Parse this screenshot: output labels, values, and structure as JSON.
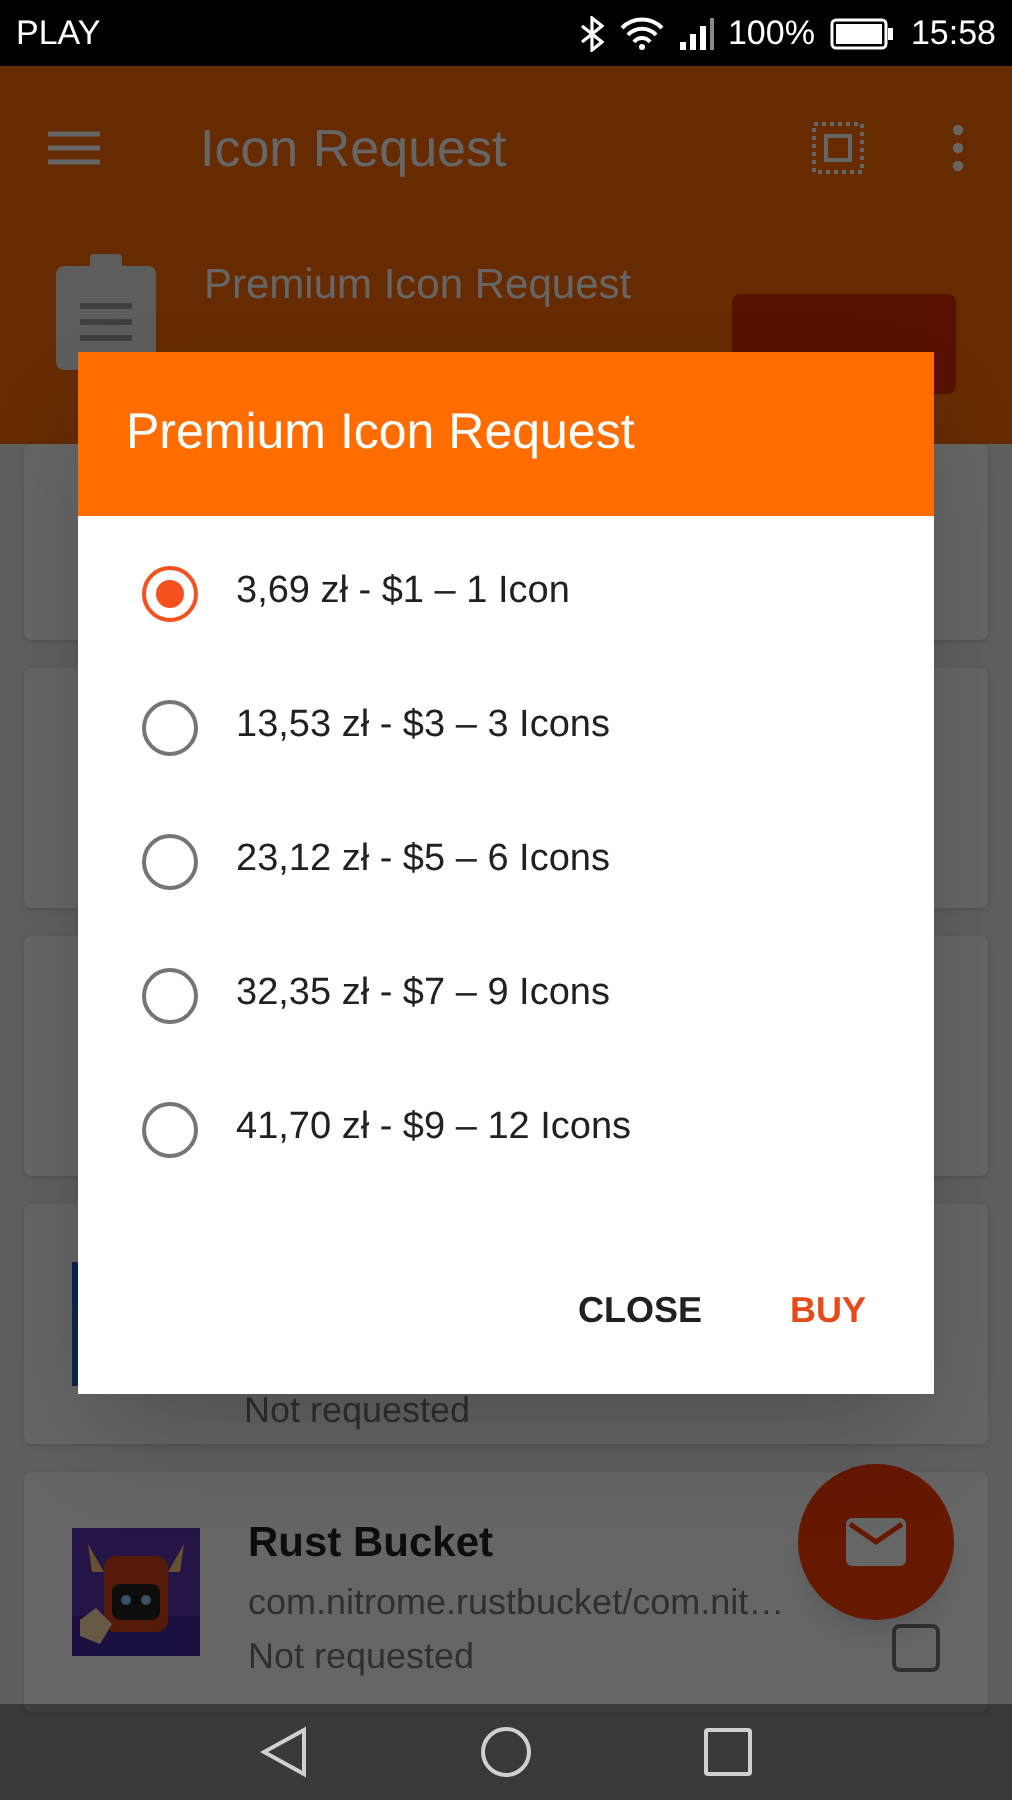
{
  "status_bar": {
    "carrier": "PLAY",
    "battery": "100%",
    "time": "15:58"
  },
  "toolbar": {
    "title": "Icon Request"
  },
  "header": {
    "title": "Premium Icon Request"
  },
  "apps": [
    {
      "status": "Not requested"
    },
    {
      "name": "Rust Bucket",
      "package": "com.nitrome.rustbucket/com.nit…",
      "status": "Not requested",
      "checked": false
    }
  ],
  "dialog": {
    "title": "Premium Icon Request",
    "options": [
      {
        "label": "3,69 zł - $1 – 1 Icon",
        "selected": true
      },
      {
        "label": "13,53 zł - $3 – 3 Icons",
        "selected": false
      },
      {
        "label": "23,12 zł - $5 – 6 Icons",
        "selected": false
      },
      {
        "label": "32,35 zł - $7 – 9 Icons",
        "selected": false
      },
      {
        "label": "41,70 zł - $9 – 12 Icons",
        "selected": false
      }
    ],
    "buttons": [
      {
        "label": "CLOSE",
        "kind": "neutral"
      },
      {
        "label": "BUY",
        "kind": "primary"
      }
    ]
  }
}
